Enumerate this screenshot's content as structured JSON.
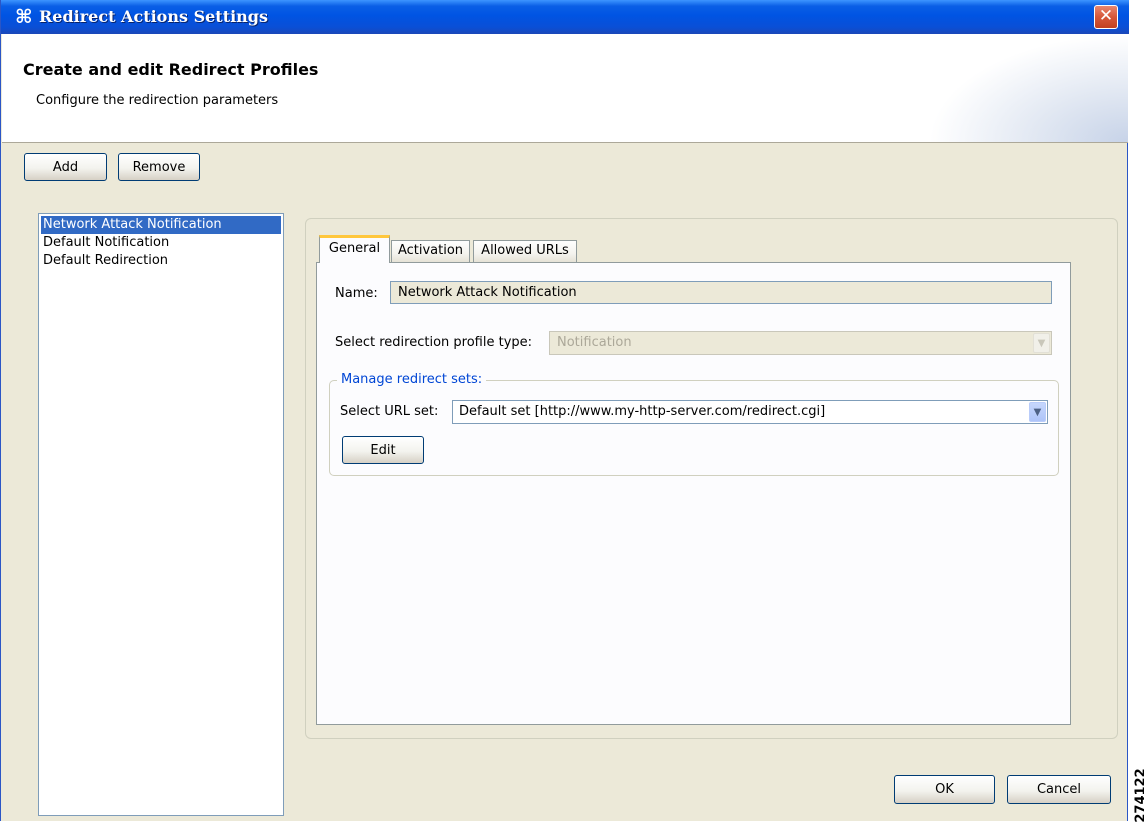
{
  "window": {
    "title": "Redirect Actions Settings",
    "app_icon": "cisco-app-icon",
    "close_glyph": "✕"
  },
  "header": {
    "title": "Create and edit Redirect Profiles",
    "subtitle": "Configure the redirection parameters"
  },
  "toolbar": {
    "add_label": "Add",
    "remove_label": "Remove"
  },
  "profiles": {
    "items": [
      "Network Attack Notification",
      "Default Notification",
      "Default Redirection"
    ],
    "selected_index": 0
  },
  "tabs": {
    "items": [
      "General",
      "Activation",
      "Allowed URLs"
    ],
    "active_index": 0
  },
  "general": {
    "name_label": "Name:",
    "name_value": "Network Attack Notification",
    "profile_type_label": "Select redirection profile type:",
    "profile_type_value": "Notification",
    "redirect_sets_legend": "Manage redirect sets:",
    "url_set_label": "Select URL set:",
    "url_set_value": "Default set [http://www.my-http-server.com/redirect.cgi]",
    "edit_label": "Edit"
  },
  "footer": {
    "ok_label": "OK",
    "cancel_label": "Cancel"
  },
  "figure_id": "274122",
  "colors": {
    "titlebar": "#0054e3",
    "dialog_bg": "#ece9d8",
    "selection": "#316ac5",
    "legend_text": "#0046d5",
    "active_tab_accent": "#ffc73c"
  }
}
